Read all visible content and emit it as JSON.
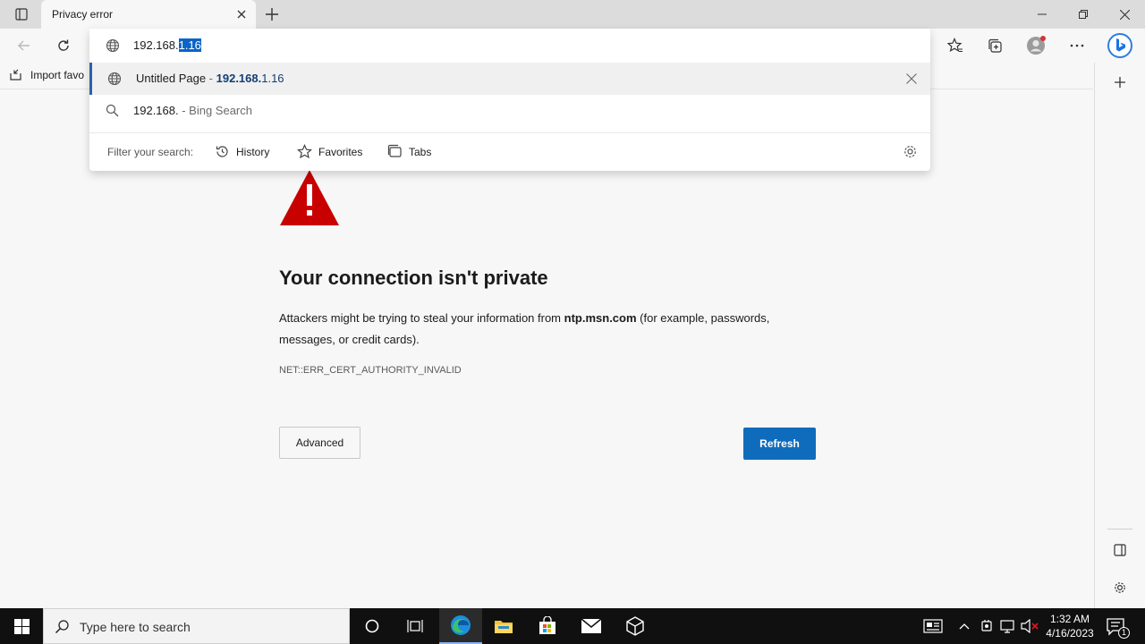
{
  "browser": {
    "tab_title": "Privacy error",
    "favorites_bar": {
      "import_label": "Import favo"
    }
  },
  "omnibox": {
    "typed_prefix": "192.168.",
    "selected_completion": "1.16",
    "suggestions": [
      {
        "title": "Untitled Page",
        "separator": " - ",
        "url_bold": "192.168.",
        "url_rest": "1.16"
      },
      {
        "query": "192.168.",
        "suffix": " - Bing Search"
      }
    ],
    "filter": {
      "label": "Filter your search:",
      "chips": [
        "History",
        "Favorites",
        "Tabs"
      ]
    }
  },
  "error_page": {
    "title": "Your connection isn't private",
    "description_pre": "Attackers might be trying to steal your information from ",
    "description_host": "ntp.msn.com",
    "description_post": " (for example, passwords, messages, or credit cards).",
    "error_code": "NET::ERR_CERT_AUTHORITY_INVALID",
    "advanced_label": "Advanced",
    "refresh_label": "Refresh"
  },
  "taskbar": {
    "search_placeholder": "Type here to search",
    "time": "1:32 AM",
    "date": "4/16/2023",
    "notification_count": "1"
  },
  "colors": {
    "accent": "#0f6cbd",
    "warning": "#c80000",
    "selection": "#0a64c8"
  }
}
